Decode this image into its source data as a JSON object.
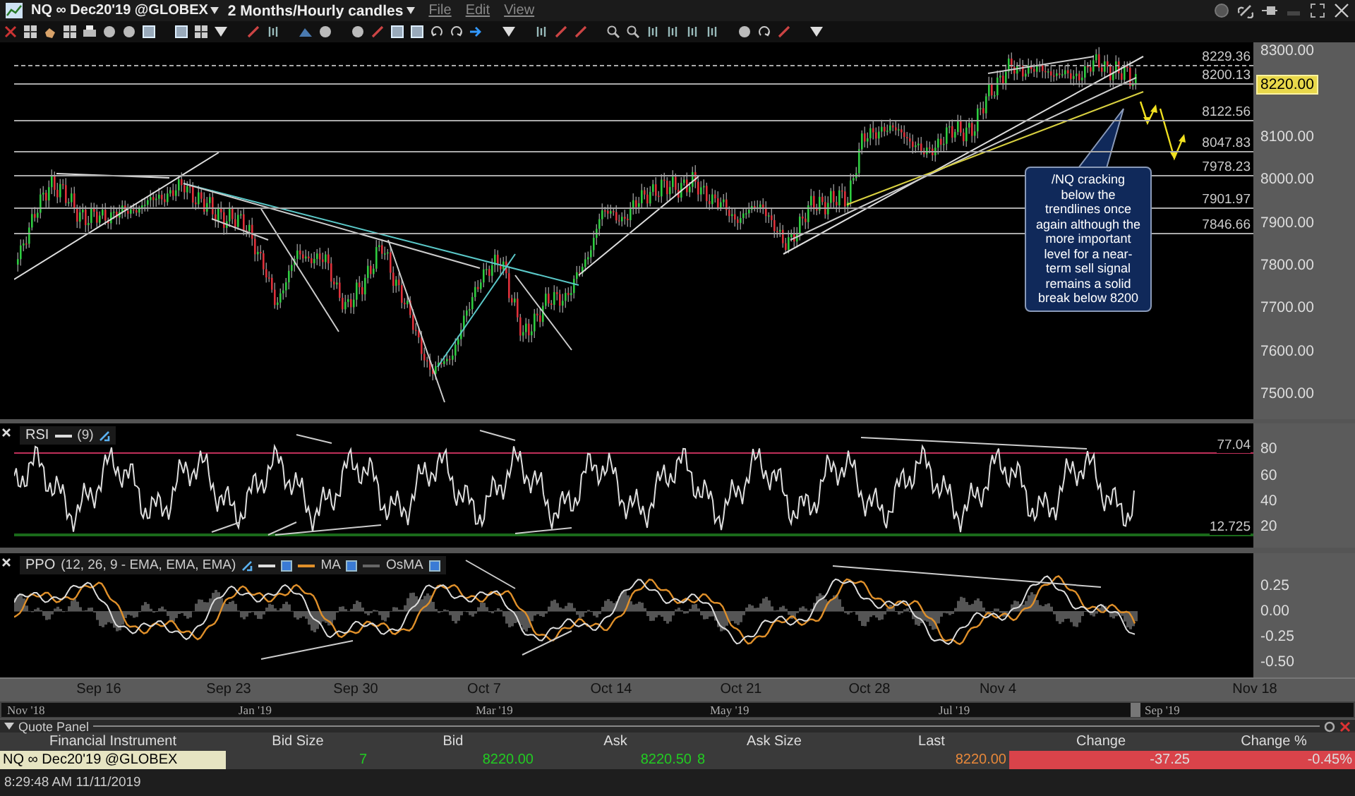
{
  "window": {
    "symbol": "NQ ∞ Dec20'19 @GLOBEX",
    "timeframe": "2 Months/Hourly candles",
    "menu": [
      "File",
      "Edit",
      "View"
    ]
  },
  "price_chart": {
    "axis": [
      "8300.00",
      "8100.00",
      "8000.00",
      "7900.00",
      "7800.00",
      "7700.00",
      "7600.00",
      "7500.00"
    ],
    "last_price": "8220.00",
    "levels": [
      {
        "label": "8229.36",
        "dashed": true
      },
      {
        "label": "8200.13",
        "dashed": false
      },
      {
        "label": "8122.56",
        "dashed": false
      },
      {
        "label": "8047.83",
        "dashed": false
      },
      {
        "label": "7978.23",
        "dashed": false
      },
      {
        "label": "7901.97",
        "dashed": false
      },
      {
        "label": "7846.66",
        "dashed": false
      }
    ],
    "note": "/NQ cracking below the trendlines once again although the more important level for a near-term sell signal remains a solid break below 8200"
  },
  "rsi": {
    "title": "RSI",
    "params": "(9)",
    "upper": "77.04",
    "lower": "12.725",
    "axis": [
      "80",
      "60",
      "40",
      "20"
    ]
  },
  "ppo": {
    "title": "PPO",
    "params": "(12, 26, 9 - EMA, EMA, EMA)",
    "axis": [
      "0.25",
      "0.00",
      "-0.25",
      "-0.50"
    ],
    "legend": [
      {
        "kind": "ppo",
        "checked": true
      },
      {
        "kind": "ma",
        "label": "MA",
        "checked": true
      },
      {
        "kind": "osma",
        "label": "OsMA",
        "checked": true
      }
    ]
  },
  "time_axis": [
    "Sep 16",
    "Sep 23",
    "Sep 30",
    "Oct 7",
    "Oct 14",
    "Oct 21",
    "Oct 28",
    "Nov 4",
    "Nov 18"
  ],
  "overview_axis": [
    "Nov '18",
    "Jan '19",
    "Mar '19",
    "May '19",
    "Jul '19",
    "Sep '19"
  ],
  "quote_panel": {
    "title": "Quote Panel",
    "columns": [
      "Financial Instrument",
      "Bid Size",
      "Bid",
      "Ask",
      "Ask Size",
      "Last",
      "Change",
      "Change %"
    ],
    "rows": [
      {
        "cells": [
          {
            "text": "NQ ∞ Dec20'19 @GLOBEX",
            "kind": "instrument",
            "color": "#000000"
          },
          {
            "text": "7",
            "kind": "plain",
            "color": "#22cc22"
          },
          {
            "text": "8220.00",
            "kind": "plain",
            "color": "#22cc22"
          },
          {
            "text": "8220.50",
            "kind": "plain",
            "color": "#22cc22"
          },
          {
            "text": "8",
            "kind": "plain",
            "color": "#22cc22"
          },
          {
            "text": "8220.00",
            "kind": "plain",
            "color": "#e8883a"
          },
          {
            "text": "-37.25",
            "kind": "alert"
          },
          {
            "text": "-0.45%",
            "kind": "alert"
          }
        ]
      }
    ]
  },
  "status_bar": {
    "time": "8:29:48 AM 11/11/2019"
  }
}
